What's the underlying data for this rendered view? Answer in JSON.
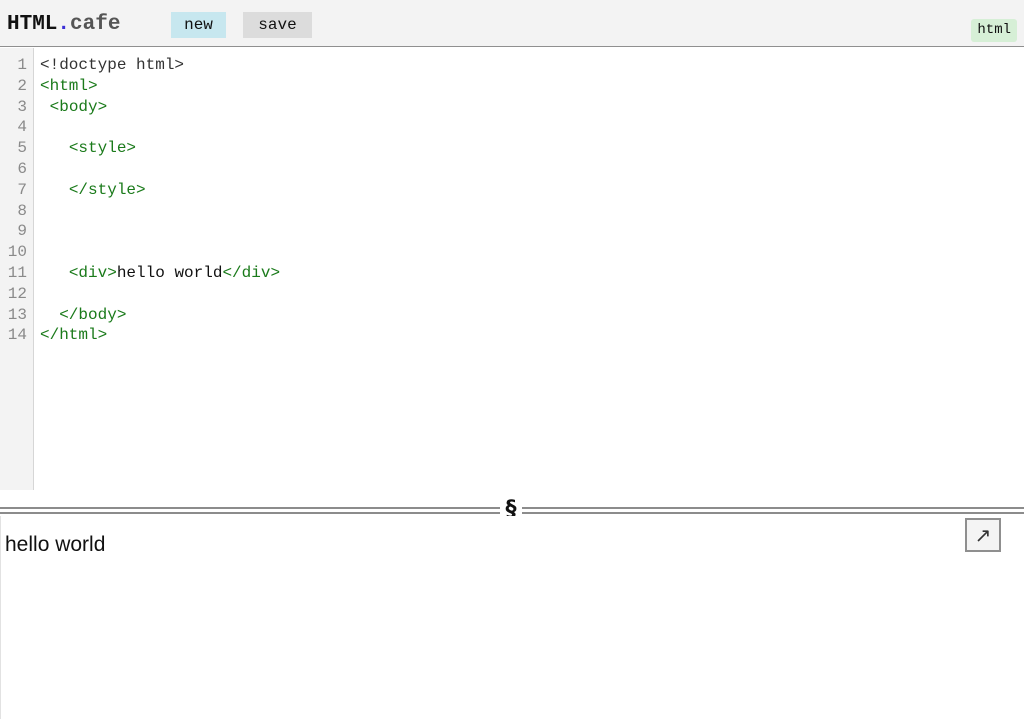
{
  "app": {
    "logo_main": "HTML",
    "logo_dot": ".",
    "logo_suffix": "cafe"
  },
  "toolbar": {
    "new_label": "new",
    "save_label": "save",
    "language_badge": "html"
  },
  "editor": {
    "line_numbers": [
      "1",
      "2",
      "3",
      "4",
      "5",
      "6",
      "7",
      "8",
      "9",
      "10",
      "11",
      "12",
      "13",
      "14"
    ],
    "lines": [
      {
        "indent": "",
        "tokens": [
          {
            "type": "doctype",
            "text": "<!doctype html>"
          }
        ]
      },
      {
        "indent": "",
        "tokens": [
          {
            "type": "tag",
            "text": "<html>"
          }
        ]
      },
      {
        "indent": " ",
        "tokens": [
          {
            "type": "tag",
            "text": "<body>"
          }
        ]
      },
      {
        "indent": "",
        "tokens": []
      },
      {
        "indent": "   ",
        "tokens": [
          {
            "type": "tag",
            "text": "<style>"
          }
        ]
      },
      {
        "indent": "",
        "tokens": []
      },
      {
        "indent": "   ",
        "tokens": [
          {
            "type": "tag",
            "text": "</style>"
          }
        ]
      },
      {
        "indent": "",
        "tokens": []
      },
      {
        "indent": "",
        "tokens": []
      },
      {
        "indent": "",
        "tokens": []
      },
      {
        "indent": "   ",
        "tokens": [
          {
            "type": "tag",
            "text": "<div>"
          },
          {
            "type": "text",
            "text": "hello world"
          },
          {
            "type": "tag",
            "text": "</div>"
          }
        ]
      },
      {
        "indent": "",
        "tokens": []
      },
      {
        "indent": "  ",
        "tokens": [
          {
            "type": "tag",
            "text": "</body>"
          }
        ]
      },
      {
        "indent": "",
        "tokens": [
          {
            "type": "tag",
            "text": "</html>"
          }
        ]
      }
    ]
  },
  "splitter": {
    "handle_glyph": "§"
  },
  "preview": {
    "content": "hello world",
    "open_icon": "↗"
  },
  "colors": {
    "tag": "#1a7a1a",
    "new_button_bg": "#c7e7ef",
    "save_button_bg": "#dcdcdc",
    "badge_bg": "#d6efd6",
    "logo_dot": "#3b2fd6"
  }
}
